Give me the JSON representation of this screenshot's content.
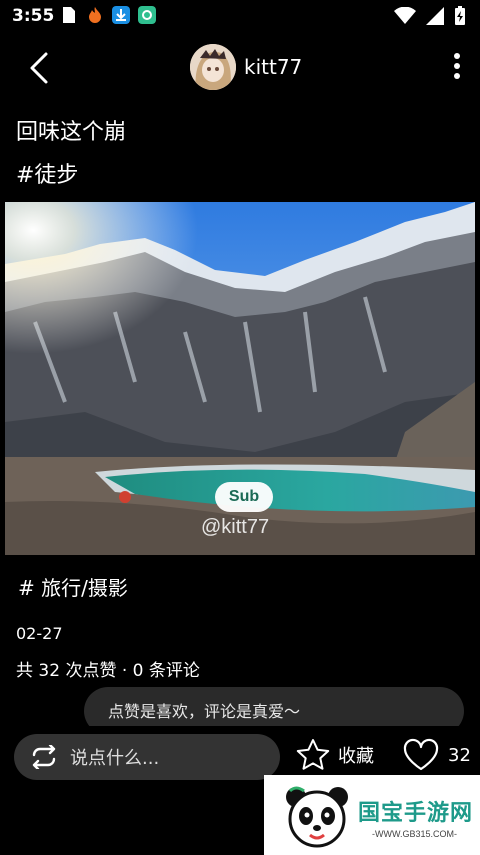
{
  "status": {
    "time": "3:55"
  },
  "header": {
    "username": "kitt77"
  },
  "post": {
    "title": "回味这个崩",
    "topic": "#徒步",
    "image": {
      "badge": "Sub",
      "watermark": "@kitt77"
    },
    "tag": "# 旅行/摄影",
    "date": "02-27",
    "stats": "共 32 次点赞 · 0 条评论"
  },
  "hint": "点赞是喜欢，评论是真爱～",
  "bottom": {
    "comment_placeholder": "说点什么...",
    "favorite_label": "收藏",
    "like_count": "32"
  },
  "logo": {
    "name": "国宝手游网",
    "url": "-WWW.GB315.COM-"
  },
  "colors": {
    "background": "#000000",
    "input_bg": "#333333",
    "logo_accent": "#1e9a8a"
  }
}
